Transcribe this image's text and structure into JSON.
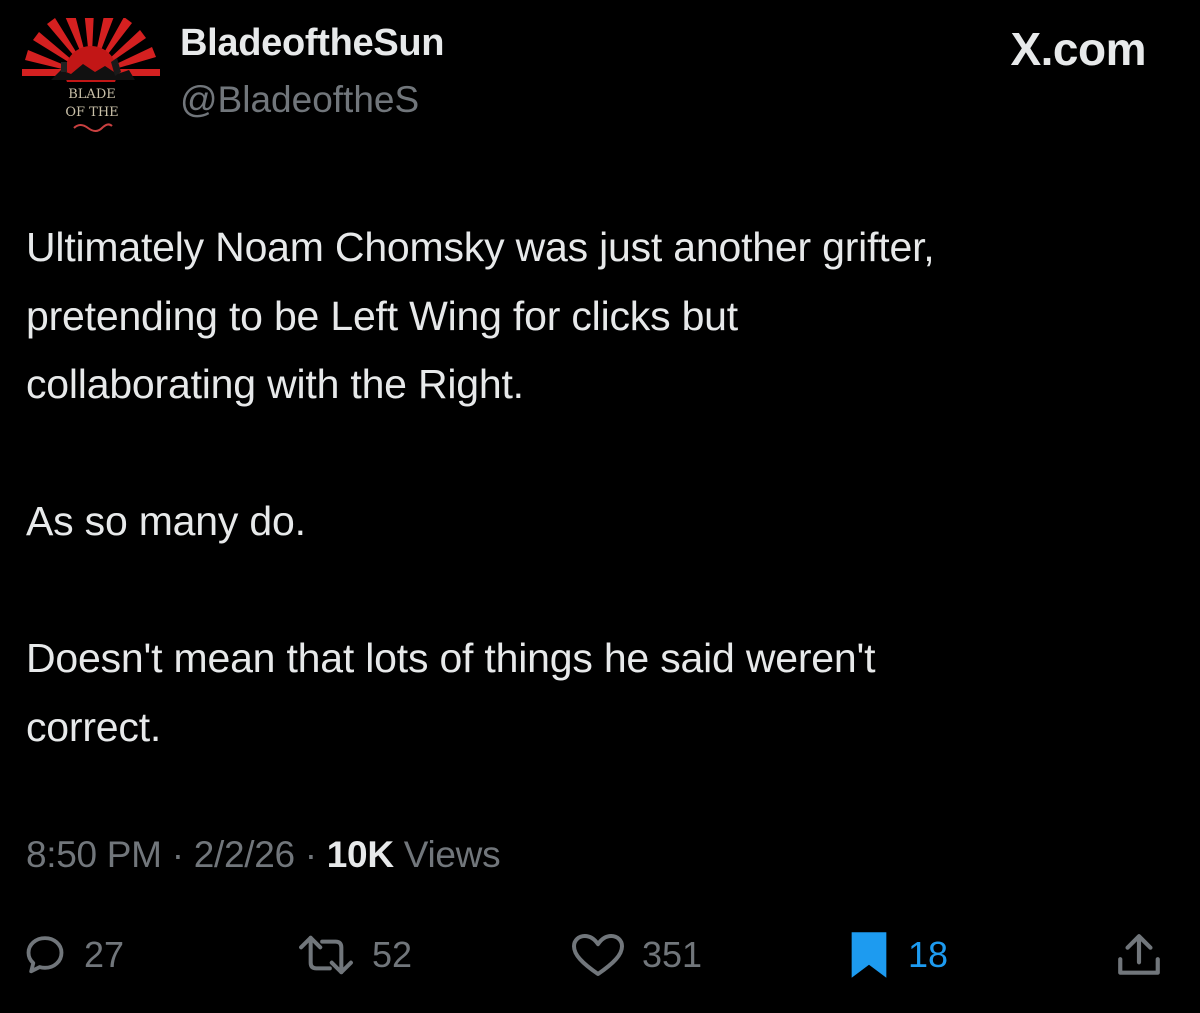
{
  "author": {
    "display_name": "BladeoftheSun",
    "handle": "@BladeoftheS",
    "avatar_text_line1": "BLADE",
    "avatar_text_line2": "OF THE"
  },
  "site": {
    "brand": "X.com"
  },
  "tweet": {
    "paragraphs": [
      "Ultimately Noam Chomsky was just another grifter,\npretending to be Left Wing for clicks but\ncollaborating with the Right.",
      "As so many do.",
      "Doesn't mean that lots of things he said weren't\ncorrect."
    ],
    "time": "8:50 PM",
    "date": "2/2/26",
    "separator": "·",
    "views_count": "10K",
    "views_label": "Views"
  },
  "actions": {
    "replies": "27",
    "reposts": "52",
    "likes": "351",
    "bookmarks": "18"
  },
  "colors": {
    "background": "#000000",
    "text_primary": "#e7e9ea",
    "text_secondary": "#71767b",
    "accent": "#1d9bf0",
    "avatar_red": "#d42020"
  },
  "icons": {
    "reply": "speech-bubble-icon",
    "repost": "repost-arrows-icon",
    "like": "heart-icon",
    "bookmark": "bookmark-filled-icon",
    "share": "share-upload-icon"
  }
}
